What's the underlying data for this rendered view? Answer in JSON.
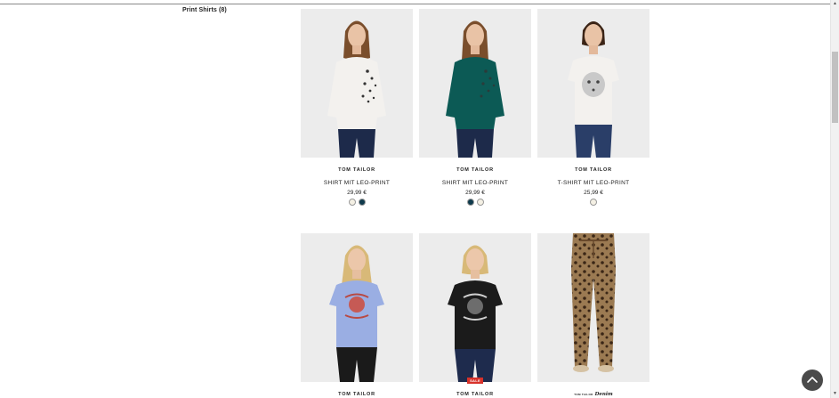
{
  "category": {
    "label": "Print Shirts (8)"
  },
  "products": [
    {
      "brand": "TOM TAILOR",
      "name": "SHIRT MIT LEO-PRINT",
      "price": "29,99 €",
      "swatches": [
        "#f4f0e4",
        "#0f3a4c"
      ],
      "shirt_color": "#f3f1ee",
      "pants_color": "#1d2a4a",
      "print": "leo-side"
    },
    {
      "brand": "TOM TAILOR",
      "name": "SHIRT MIT LEO-PRINT",
      "price": "29,99 €",
      "swatches": [
        "#0f3a4c",
        "#f4f0e4"
      ],
      "shirt_color": "#0c5a55",
      "pants_color": "#1d2a4a",
      "print": "leo-side"
    },
    {
      "brand": "TOM TAILOR",
      "name": "T-SHIRT MIT LEO-PRINT",
      "price": "25,99 €",
      "swatches": [
        "#f4f0e4"
      ],
      "shirt_color": "#f3f1ee",
      "pants_color": "#2a3e68",
      "print": "leopard-face"
    },
    {
      "brand": "TOM TAILOR",
      "shirt_color": "#9aaee3",
      "pants_color": "#1a1a1a",
      "print": "wild-love"
    },
    {
      "brand": "TOM TAILOR",
      "badge": "SALE",
      "shirt_color": "#1b1b1b",
      "pants_color": "#1e2b4d",
      "print": "wild-love-dark"
    },
    {
      "brand": "Denim",
      "brand_prefix": "TOM TAILOR",
      "pants_color": "#8a6a45",
      "print": "leopard-pants"
    }
  ],
  "icons": {
    "back_to_top": "chevron-up-icon",
    "scroll_up": "triangle-up-icon",
    "scroll_down": "triangle-down-icon"
  }
}
